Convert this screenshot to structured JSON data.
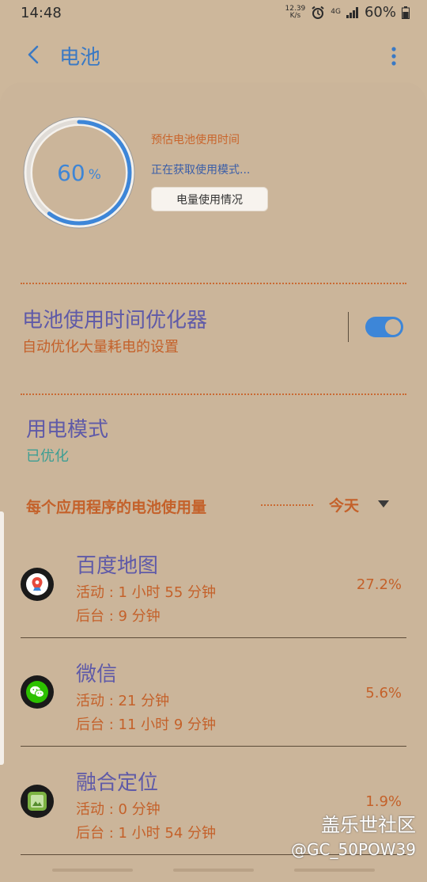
{
  "status": {
    "time": "14:48",
    "net_speed_value": "12.39",
    "net_speed_unit": "K/s",
    "network": "4G",
    "battery": "60%"
  },
  "header": {
    "title": "电池"
  },
  "battery": {
    "level": 60,
    "level_number": "60",
    "level_unit": "%",
    "estimate_label": "预估电池使用时间",
    "estimate_value": "正在获取使用模式...",
    "usage_button": "电量使用情况"
  },
  "optimizer": {
    "title": "电池使用时间优化器",
    "subtitle": "自动优化大量耗电的设置",
    "enabled": true
  },
  "power_mode": {
    "title": "用电模式",
    "value": "已优化"
  },
  "app_usage": {
    "section_title": "每个应用程序的电池使用量",
    "period": "今天",
    "apps": [
      {
        "name": "百度地图",
        "active": "活动 : 1 小时 55 分钟",
        "background": "后台 : 9 分钟",
        "percent": "27.2%",
        "icon": "baidu-map-icon"
      },
      {
        "name": "微信",
        "active": "活动 : 21 分钟",
        "background": "后台 : 11 小时 9 分钟",
        "percent": "5.6%",
        "icon": "wechat-icon"
      },
      {
        "name": "融合定位",
        "active": "活动 : 0 分钟",
        "background": "后台 : 1 小时 54 分钟",
        "percent": "1.9%",
        "icon": "android-app-icon"
      }
    ]
  },
  "watermark": {
    "line1": "盖乐世社区",
    "line2": "@GC_50POW39"
  },
  "colors": {
    "accent": "#3d86d8",
    "orange": "#c4612a",
    "purple": "#5f5aa8",
    "teal": "#3d9e93",
    "background": "#cdb79b"
  }
}
